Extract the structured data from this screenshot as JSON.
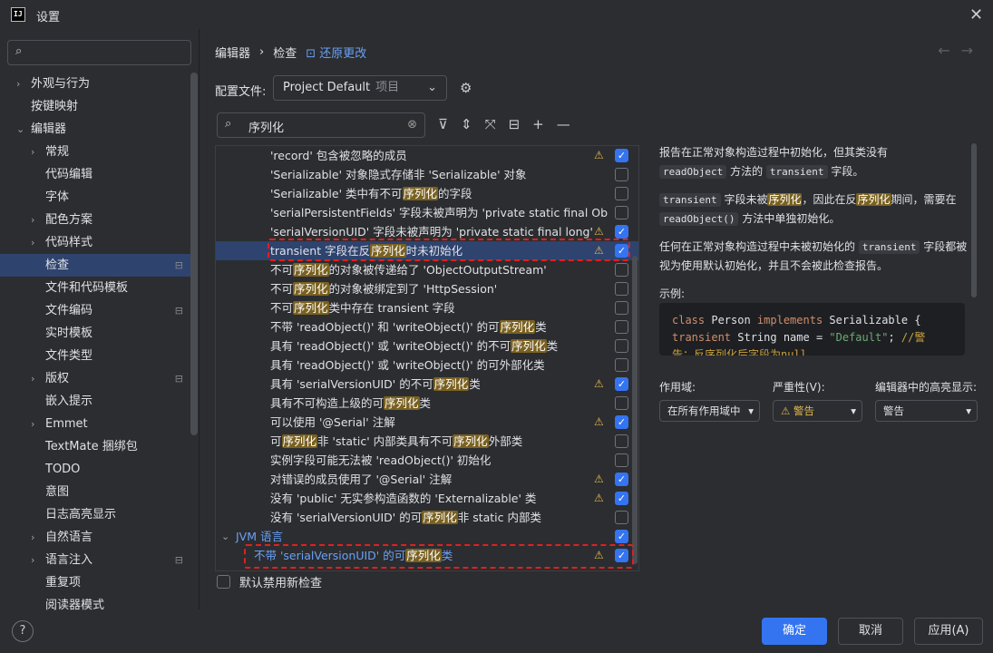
{
  "window": {
    "title": "设置",
    "close": "✕"
  },
  "sidebar": {
    "items": [
      {
        "label": "外观与行为",
        "indent": 34,
        "chev": ">"
      },
      {
        "label": "按键映射",
        "indent": 34
      },
      {
        "label": "编辑器",
        "indent": 34,
        "chev": "v"
      },
      {
        "label": "常规",
        "indent": 50,
        "chev": ">"
      },
      {
        "label": "代码编辑",
        "indent": 50
      },
      {
        "label": "字体",
        "indent": 50
      },
      {
        "label": "配色方案",
        "indent": 50,
        "chev": ">"
      },
      {
        "label": "代码样式",
        "indent": 50,
        "chev": ">"
      },
      {
        "label": "检查",
        "indent": 50,
        "selected": true,
        "pin": true
      },
      {
        "label": "文件和代码模板",
        "indent": 50
      },
      {
        "label": "文件编码",
        "indent": 50,
        "pin": true
      },
      {
        "label": "实时模板",
        "indent": 50
      },
      {
        "label": "文件类型",
        "indent": 50
      },
      {
        "label": "版权",
        "indent": 50,
        "chev": ">",
        "pin": true
      },
      {
        "label": "嵌入提示",
        "indent": 50
      },
      {
        "label": "Emmet",
        "indent": 50,
        "chev": ">"
      },
      {
        "label": "TextMate 捆绑包",
        "indent": 50
      },
      {
        "label": "TODO",
        "indent": 50
      },
      {
        "label": "意图",
        "indent": 50
      },
      {
        "label": "日志高亮显示",
        "indent": 50
      },
      {
        "label": "自然语言",
        "indent": 50,
        "chev": ">"
      },
      {
        "label": "语言注入",
        "indent": 50,
        "chev": ">",
        "pin": true
      },
      {
        "label": "重复项",
        "indent": 50
      },
      {
        "label": "阅读器模式",
        "indent": 50
      }
    ]
  },
  "breadcrumb": {
    "part1": "编辑器",
    "sep": "›",
    "part2": "检查",
    "revert": "还原更改"
  },
  "profile": {
    "label": "配置文件:",
    "value": "Project Default",
    "sub": "项目"
  },
  "filter": {
    "value": "序列化"
  },
  "inspections": [
    {
      "pre": "'record' 包含被忽略的成员",
      "warn": true,
      "checked": true
    },
    {
      "pre": "'Serializable' 对象隐式存储非 'Serializable' 对象",
      "warn": false,
      "checked": false
    },
    {
      "pre": "'Serializable' 类中有不可",
      "hl": "序列化",
      "post": "的字段",
      "warn": false,
      "checked": false
    },
    {
      "pre": "'serialPersistentFields' 字段未被声明为 'private static final Ob",
      "warn": false,
      "checked": false
    },
    {
      "pre": "'serialVersionUID' 字段未被声明为 'private static final long'",
      "warn": true,
      "checked": true
    },
    {
      "pre": "transient 字段在反",
      "hl": "序列化",
      "post": "时未初始化",
      "warn": true,
      "checked": true,
      "selected": true
    },
    {
      "pre": "不可",
      "hl": "序列化",
      "post": "的对象被传递给了 'ObjectOutputStream'",
      "warn": false,
      "checked": false
    },
    {
      "pre": "不可",
      "hl": "序列化",
      "post": "的对象被绑定到了 'HttpSession'",
      "warn": false,
      "checked": false
    },
    {
      "pre": "不可",
      "hl": "序列化",
      "post": "类中存在 transient 字段",
      "warn": false,
      "checked": false
    },
    {
      "pre": "不带 'readObject()' 和 'writeObject()' 的可",
      "hl": "序列化",
      "post": "类",
      "warn": false,
      "checked": false
    },
    {
      "pre": "具有 'readObject()' 或 'writeObject()' 的不可",
      "hl": "序列化",
      "post": "类",
      "warn": false,
      "checked": false
    },
    {
      "pre": "具有 'readObject()' 或 'writeObject()' 的可外部化类",
      "warn": false,
      "checked": false
    },
    {
      "pre": "具有 'serialVersionUID' 的不可",
      "hl": "序列化",
      "post": "类",
      "warn": true,
      "checked": true
    },
    {
      "pre": "具有不可构造上级的可",
      "hl": "序列化",
      "post": "类",
      "warn": false,
      "checked": false
    },
    {
      "pre": "可以使用 '@Serial' 注解",
      "warn": true,
      "checked": true
    },
    {
      "pre": "可",
      "hl": "序列化",
      "post": "非 'static' 内部类具有不可",
      "hl2": "序列化",
      "post2": "外部类",
      "warn": false,
      "checked": false
    },
    {
      "pre": "实例字段可能无法被 'readObject()' 初始化",
      "warn": false,
      "checked": false
    },
    {
      "pre": "对错误的成员使用了 '@Serial' 注解",
      "warn": true,
      "checked": true
    },
    {
      "pre": "没有 'public' 无实参构造函数的 'Externalizable' 类",
      "warn": true,
      "checked": true
    },
    {
      "pre": "没有 'serialVersionUID' 的可",
      "hl": "序列化",
      "post": "非 static 内部类",
      "warn": false,
      "checked": false
    }
  ],
  "group": {
    "label": "JVM 语言",
    "checked": true
  },
  "group_item": {
    "pre": "不带 'serialVersionUID' 的可",
    "hl": "序列化",
    "post": "类",
    "warn": true,
    "checked": true
  },
  "default_disabled": "默认禁用新检查",
  "description": {
    "p1_a": "报告在正常对象构造过程中初始化，但其类没有",
    "p1_code1": "readObject",
    "p1_b": "方法的",
    "p1_code2": "transient",
    "p1_c": "字段。",
    "p2_code1": "transient",
    "p2_a": "字段未被",
    "p2_hl1": "序列化",
    "p2_b": "，因此在反",
    "p2_hl2": "序列化",
    "p2_c": "期间，需要在",
    "p2_code2": "readObject()",
    "p2_d": "方法中单独初始化。",
    "p3_a": "任何在正常对象构造过程中未被初始化的",
    "p3_code": "transient",
    "p3_b": "字段都被视为使用默认初始化，并且不会被此检查报告。",
    "example": "示例:"
  },
  "code": {
    "line1_kw1": "class",
    "line1_a": " Person ",
    "line1_kw2": "implements",
    "line1_b": " Serializable {",
    "line2_kw": "  transient",
    "line2_a": " String name = ",
    "line2_str": "\"Default\"",
    "line2_b": "; ",
    "line2_cmt": "//警",
    "line3": "告：反序列化后字段为null"
  },
  "scope": {
    "label": "作用域:",
    "value": "在所有作用域中"
  },
  "severity": {
    "label": "严重性(V):",
    "value": "⚠ 警告"
  },
  "highlight": {
    "label": "编辑器中的高亮显示:",
    "value": "警告"
  },
  "buttons": {
    "ok": "确定",
    "cancel": "取消",
    "apply": "应用(A)",
    "help": "?"
  }
}
